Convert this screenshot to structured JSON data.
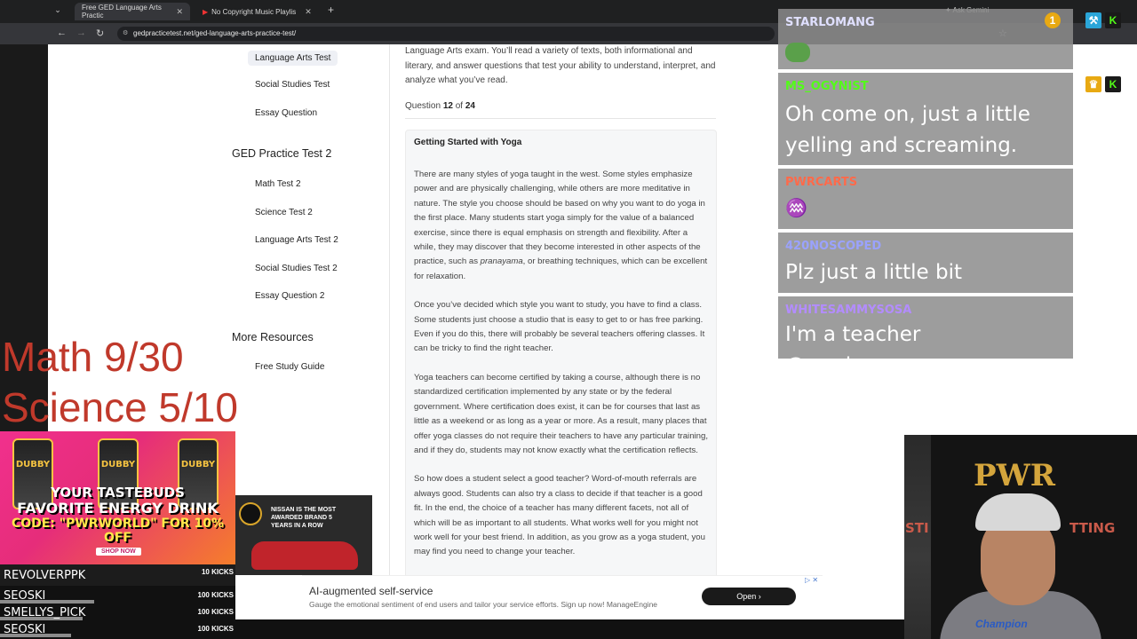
{
  "browser": {
    "tabs": [
      {
        "label": "Free GED Language Arts Practic",
        "close": "✕"
      },
      {
        "label": "No Copyright Music Playlis",
        "close": "✕"
      }
    ],
    "new_tab": "+",
    "url": "gedpracticetest.net/ged-language-arts-practice-test/",
    "gemini_label": "Ask Gemini"
  },
  "sidebar": {
    "items_top": [
      {
        "label": "Language Arts Test",
        "active": true
      },
      {
        "label": "Social Studies Test"
      },
      {
        "label": "Essay Question"
      }
    ],
    "section2_title": "GED Practice Test 2",
    "section2_items": [
      "Math Test 2",
      "Science Test 2",
      "Language Arts Test 2",
      "Social Studies Test 2",
      "Essay Question 2"
    ],
    "section3_title": "More Resources",
    "section3_items": [
      "Free Study Guide"
    ]
  },
  "main": {
    "intro": "Language Arts exam. You’ll read a variety of texts, both informational and literary, and answer questions that test your ability to understand, interpret, and analyze what you’ve read.",
    "question_prefix": "Question",
    "question_num": "12",
    "question_of": "of",
    "question_total": "24",
    "passage_title": "Getting Started with Yoga",
    "p1_a": "There are many styles of yoga taught in the west. Some styles emphasize power and are physically challenging, while others are more meditative in nature. The style you choose should be based on why you want to do yoga in the first place. Many students start yoga simply for the value of a balanced exercise, since there is equal emphasis on strength and flexibility. After a while, they may discover that they become interested in other aspects of the practice, such as ",
    "p1_em": "pranayama",
    "p1_b": ", or breathing techniques, which can be excellent for relaxation.",
    "p2": "Once you’ve decided which style you want to study, you have to find a class. Some students just choose a studio that is easy to get to or has free parking. Even if you do this, there will probably be several teachers offering classes. It can be tricky to find the right teacher.",
    "p3": "Yoga teachers can become certified by taking a course, although there is no standardized certification implemented by any state or by the federal government. Where certification does exist, it can be for courses that last as little as a weekend or as long as a year or more. As a result, many places that offer yoga classes do not require their teachers to have any particular training, and if they do, students may not know exactly what the certification reflects.",
    "p4": "So how does a student select a good teacher? Word-of-mouth referrals are always good. Students can also try a class to decide if that teacher is a good fit. In the end, the choice of a teacher has many different facets, not all of which will be as important to all students. What works well for you might not work well for your best friend. In addition, as you grow as a yoga student, you may find you need to change your teacher."
  },
  "ad": {
    "title": "AI-augmented self-service",
    "desc": "Gauge the emotional sentiment of end users and tailor your service efforts. Sign up now! ManageEngine",
    "button": "Open"
  },
  "overlay": {
    "math": "Math 9/30",
    "science": "Science 5/10"
  },
  "promo": {
    "can_label": "DUBBY",
    "line1": "YOUR TASTEBUDS",
    "line2": "FAVORITE ENERGY DRINK",
    "line3": "CODE: \"PWRWORLD\" FOR 10% OFF",
    "shop": "SHOP NOW"
  },
  "nissan": {
    "text": "NISSAN IS THE MOST AWARDED BRAND 5 YEARS IN A ROW"
  },
  "leaderboard": [
    {
      "name": "REVOLVERPPK",
      "kicks": "10 KICKS",
      "fill": 1.0
    },
    {
      "name": "SEOSKI",
      "kicks": "100 KICKS",
      "fill": 0.4
    },
    {
      "name": "SMELLYS_PICK",
      "kicks": "100 KICKS",
      "fill": 0.35
    },
    {
      "name": "SEOSKI",
      "kicks": "100 KICKS",
      "fill": 0.3
    }
  ],
  "chat": [
    {
      "user": "STARLOMANG",
      "color": "#e0e0ff"
    },
    {
      "user": "MS_OGYNIST",
      "color": "#53fc18",
      "text": "Oh come on, just a little yelling and screaming."
    },
    {
      "user": "PWRCARTS",
      "color": "#ff6a4a"
    },
    {
      "user": "420NOSCOPED",
      "color": "#9aa2ff",
      "text": "Plz just a little bit"
    },
    {
      "user": "WHITESAMMYSOSA",
      "color": "#b38cff",
      "text": "I'm a teacher @madame_may"
    }
  ],
  "notification_count": "1",
  "webcam": {
    "logo": "PWR",
    "side_right": "TTING",
    "side_left": "STI",
    "shirt": "Champion"
  }
}
